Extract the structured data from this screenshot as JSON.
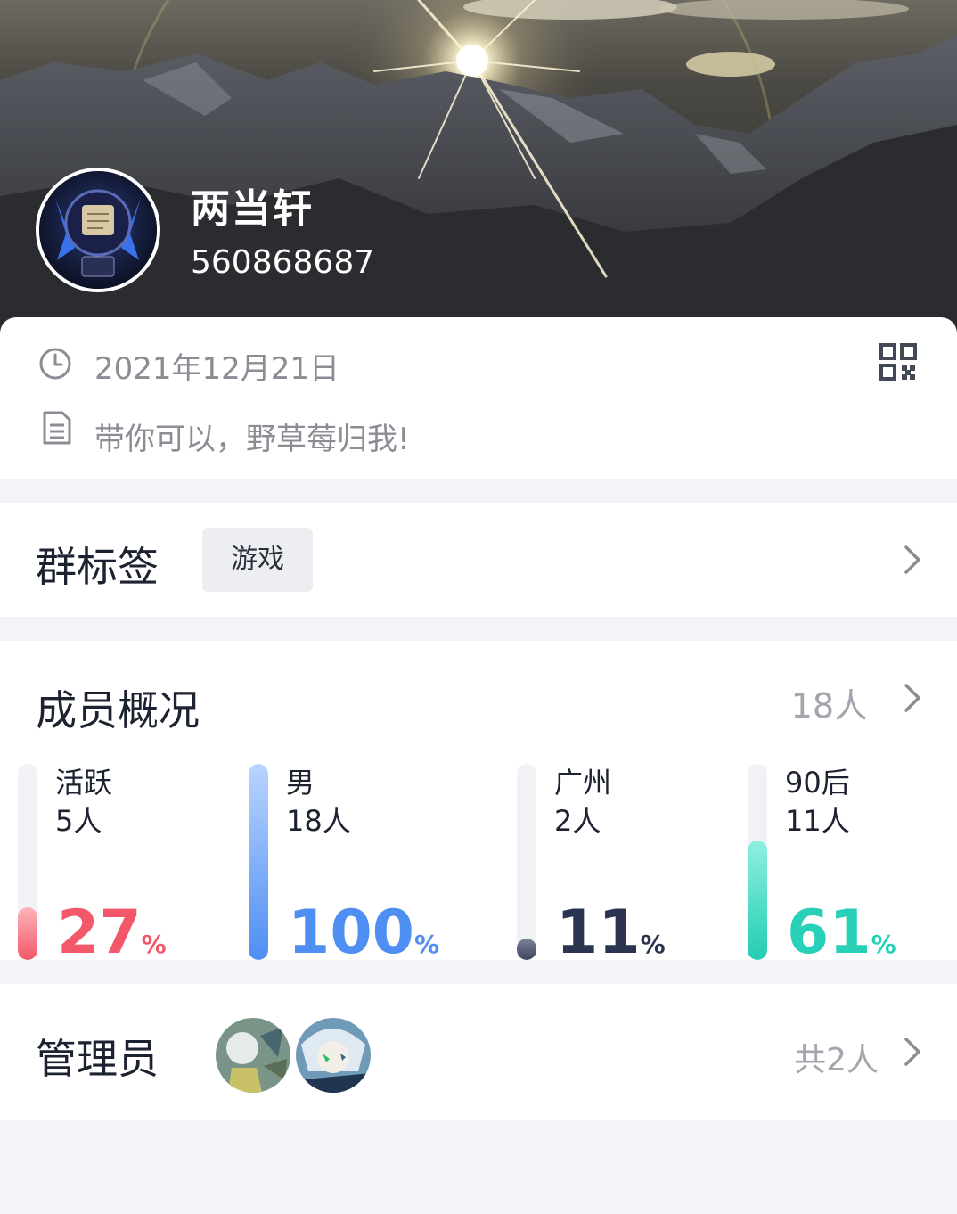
{
  "header": {
    "group_name": "两当轩",
    "group_id": "560868687"
  },
  "info": {
    "created_date": "2021年12月21日",
    "description": "带你可以，野草莓归我!"
  },
  "tags": {
    "title": "群标签",
    "items": [
      "游戏"
    ]
  },
  "members": {
    "title": "成员概况",
    "total": "18人",
    "stats": [
      {
        "label": "活跃",
        "count": "5人",
        "percent": "27",
        "unit": "%",
        "fill": 0.27,
        "color": "#f2586a",
        "fill_from": "#ffb3bb",
        "fill_to": "#f2586a"
      },
      {
        "label": "男",
        "count": "18人",
        "percent": "100",
        "unit": "%",
        "fill": 1.0,
        "color": "#4f8ef2",
        "fill_from": "#b9d4ff",
        "fill_to": "#4f8ef2"
      },
      {
        "label": "广州",
        "count": "2人",
        "percent": "11",
        "unit": "%",
        "fill": 0.11,
        "color": "#2a3450",
        "fill_from": "#7b8196",
        "fill_to": "#3f4662"
      },
      {
        "label": "90后",
        "count": "11人",
        "percent": "61",
        "unit": "%",
        "fill": 0.61,
        "color": "#27d0b6",
        "fill_from": "#8ff0e0",
        "fill_to": "#22cdb2"
      }
    ]
  },
  "admins": {
    "title": "管理员",
    "total": "共2人"
  },
  "icons": {
    "clock": "clock-icon",
    "document": "document-icon",
    "qr": "qr-code-icon",
    "chevron": "chevron-right-icon"
  }
}
